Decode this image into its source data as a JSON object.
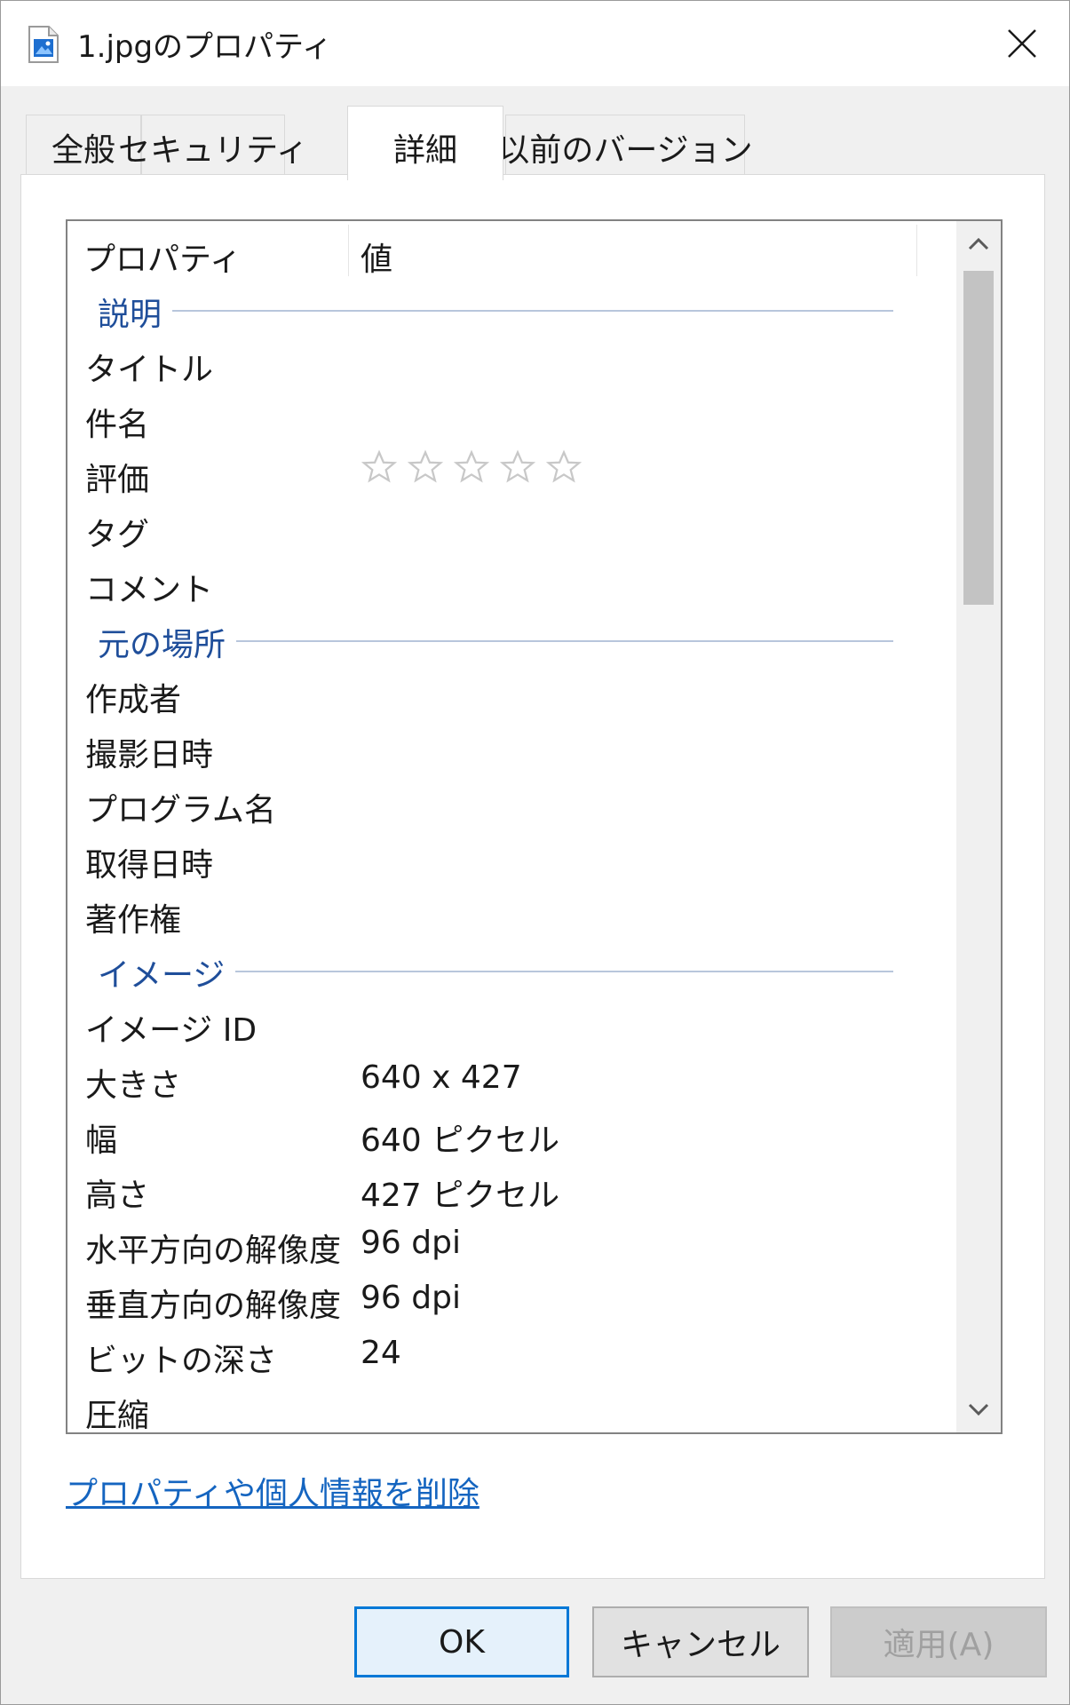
{
  "window": {
    "title": "1.jpgのプロパティ",
    "icon": "image-file-icon",
    "close_icon": "close-icon"
  },
  "tabs": [
    {
      "label": "全般",
      "active": false
    },
    {
      "label": "セキュリティ",
      "active": false
    },
    {
      "label": "詳細",
      "active": true
    },
    {
      "label": "以前のバージョン",
      "active": false
    }
  ],
  "list": {
    "headers": {
      "property": "プロパティ",
      "value": "値"
    },
    "groups": {
      "description": "説明",
      "origin": "元の場所",
      "image": "イメージ"
    },
    "rows": {
      "title": {
        "label": "タイトル",
        "value": ""
      },
      "subject": {
        "label": "件名",
        "value": ""
      },
      "rating": {
        "label": "評価",
        "stars": 0,
        "max_stars": 5
      },
      "tags": {
        "label": "タグ",
        "value": ""
      },
      "comment": {
        "label": "コメント",
        "value": ""
      },
      "author": {
        "label": "作成者",
        "value": ""
      },
      "date_taken": {
        "label": "撮影日時",
        "value": ""
      },
      "program": {
        "label": "プログラム名",
        "value": ""
      },
      "date_acquired": {
        "label": "取得日時",
        "value": ""
      },
      "copyright": {
        "label": "著作権",
        "value": ""
      },
      "image_id": {
        "label": "イメージ ID",
        "value": ""
      },
      "dimensions": {
        "label": "大きさ",
        "value": "640 x 427"
      },
      "width": {
        "label": "幅",
        "value": "640 ピクセル"
      },
      "height": {
        "label": "高さ",
        "value": "427 ピクセル"
      },
      "h_resolution": {
        "label": "水平方向の解像度",
        "value": "96 dpi"
      },
      "v_resolution": {
        "label": "垂直方向の解像度",
        "value": "96 dpi"
      },
      "bit_depth": {
        "label": "ビットの深さ",
        "value": "24"
      },
      "compression": {
        "label": "圧縮",
        "value": ""
      }
    }
  },
  "link": {
    "remove_properties": "プロパティや個人情報を削除"
  },
  "buttons": {
    "ok": "OK",
    "cancel": "キャンセル",
    "apply": "適用(A)"
  },
  "colors": {
    "group_label": "#1f4e9a",
    "link": "#1565c0",
    "ok_border": "#0078d7",
    "star": "#c8c8c8"
  }
}
